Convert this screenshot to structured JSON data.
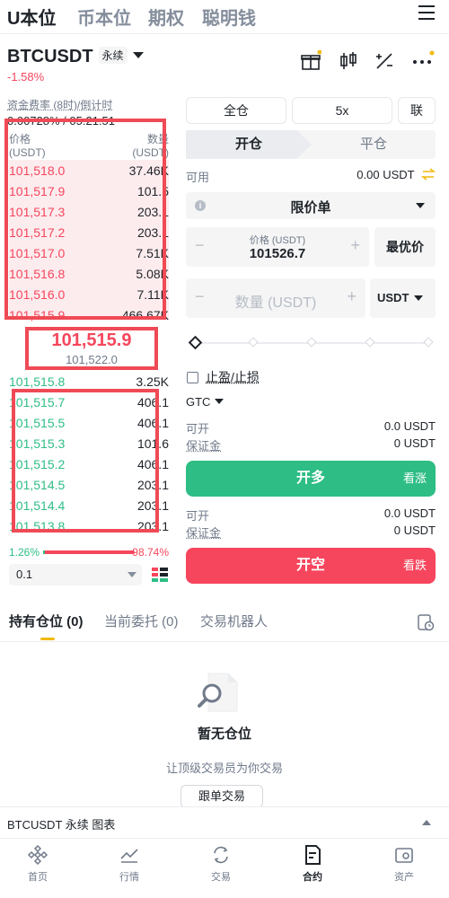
{
  "top_tabs": [
    "U本位",
    "币本位",
    "期权",
    "聪明钱"
  ],
  "pair": {
    "name": "BTCUSDT",
    "type": "永续",
    "change": "-1.58%"
  },
  "funding": {
    "label": "资金费率 (8时)/倒计时",
    "value": "0.00728% / 05:21:51"
  },
  "orderbook": {
    "price_header": "价格",
    "price_unit": "(USDT)",
    "qty_header": "数量",
    "qty_unit": "(USDT)",
    "asks": [
      {
        "price": "101,518.0",
        "qty": "37.46K"
      },
      {
        "price": "101,517.9",
        "qty": "101.5"
      },
      {
        "price": "101,517.3",
        "qty": "203.1"
      },
      {
        "price": "101,517.2",
        "qty": "203.1"
      },
      {
        "price": "101,517.0",
        "qty": "7.51K"
      },
      {
        "price": "101,516.8",
        "qty": "5.08K"
      },
      {
        "price": "101,516.0",
        "qty": "7.11K"
      },
      {
        "price": "101,515.9",
        "qty": "466.67K"
      }
    ],
    "last_price": "101,515.9",
    "mark_price": "101,522.0",
    "bids": [
      {
        "price": "101,515.8",
        "qty": "3.25K"
      },
      {
        "price": "101,515.7",
        "qty": "406.1"
      },
      {
        "price": "101,515.5",
        "qty": "406.1"
      },
      {
        "price": "101,515.3",
        "qty": "101.6"
      },
      {
        "price": "101,515.2",
        "qty": "406.1"
      },
      {
        "price": "101,514.5",
        "qty": "203.1"
      },
      {
        "price": "101,514.4",
        "qty": "203.1"
      },
      {
        "price": "101,513.8",
        "qty": "203.1"
      }
    ],
    "buy_ratio": "1.26%",
    "sell_ratio": "98.74%",
    "buy_fraction": 0.0126,
    "depth": "0.1"
  },
  "margin": {
    "mode": "全仓",
    "leverage": "5x",
    "asset_mode": "联"
  },
  "oc_tabs": {
    "open": "开仓",
    "close": "平仓"
  },
  "available": {
    "label": "可用",
    "value": "0.00 USDT"
  },
  "order_type": "限价单",
  "price_field": {
    "label": "价格 (USDT)",
    "value": "101526.7",
    "best": "最优价"
  },
  "qty_field": {
    "placeholder": "数量 (USDT)",
    "unit": "USDT"
  },
  "tpsl": "止盈/止损",
  "tif": "GTC",
  "long_info": {
    "open_label": "可开",
    "open_value": "0.0 USDT",
    "margin_label": "保证金",
    "margin_value": "0 USDT"
  },
  "short_info": {
    "open_label": "可开",
    "open_value": "0.0 USDT",
    "margin_label": "保证金",
    "margin_value": "0 USDT"
  },
  "long_button": {
    "label": "开多",
    "side": "看涨"
  },
  "short_button": {
    "label": "开空",
    "side": "看跌"
  },
  "position_tabs": [
    "持有仓位 (0)",
    "当前委托 (0)",
    "交易机器人"
  ],
  "empty": {
    "title": "暂无仓位",
    "subtitle": "让顶级交易员为你交易",
    "button": "跟单交易"
  },
  "chart_bar": "BTCUSDT 永续  图表",
  "bottom_nav": [
    "首页",
    "行情",
    "交易",
    "合约",
    "资产"
  ],
  "colors": {
    "red": "#f6465d",
    "green": "#2ebd85",
    "yellow": "#f0b90b",
    "annotation": "#ef4a55"
  }
}
